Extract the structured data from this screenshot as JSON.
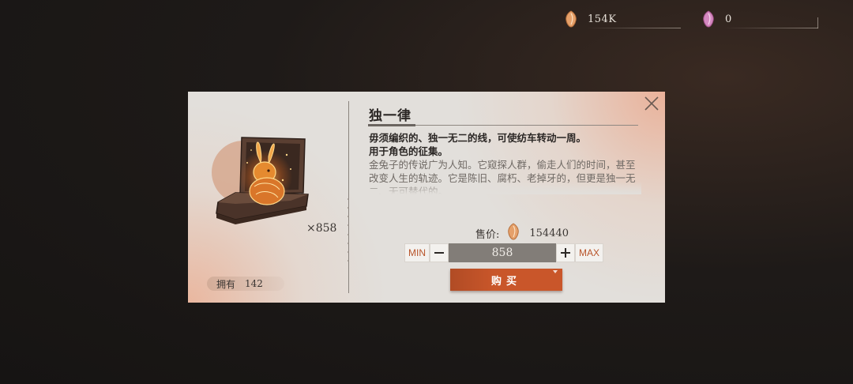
{
  "currencies": [
    {
      "icon": "orange-gem-icon",
      "color": "#e8a36a",
      "amount": "154K"
    },
    {
      "icon": "pink-gem-icon",
      "color": "#d67fb8",
      "amount": "0"
    }
  ],
  "dialog": {
    "item": {
      "name": "独一律",
      "count": "×858",
      "owned_label": "拥有",
      "owned_value": "142",
      "description_bold_1": "毋须编织的、独一无二的线，可使纺车转动一周。",
      "description_bold_2": "用于角色的征集。",
      "description_lore": "金兔子的传说广为人知。它窥探人群，偷走人们的时间，甚至改变人生的轨迹。它是陈旧、腐朽、老掉牙的，但更是独一无二、无可替代的。"
    },
    "price": {
      "label": "售价:",
      "currency_icon": "orange-gem-icon",
      "value": "154440"
    },
    "quantity": {
      "min_label": "MIN",
      "max_label": "MAX",
      "value": "858"
    },
    "buy_label": "购买",
    "accent_color": "#c9562a"
  }
}
